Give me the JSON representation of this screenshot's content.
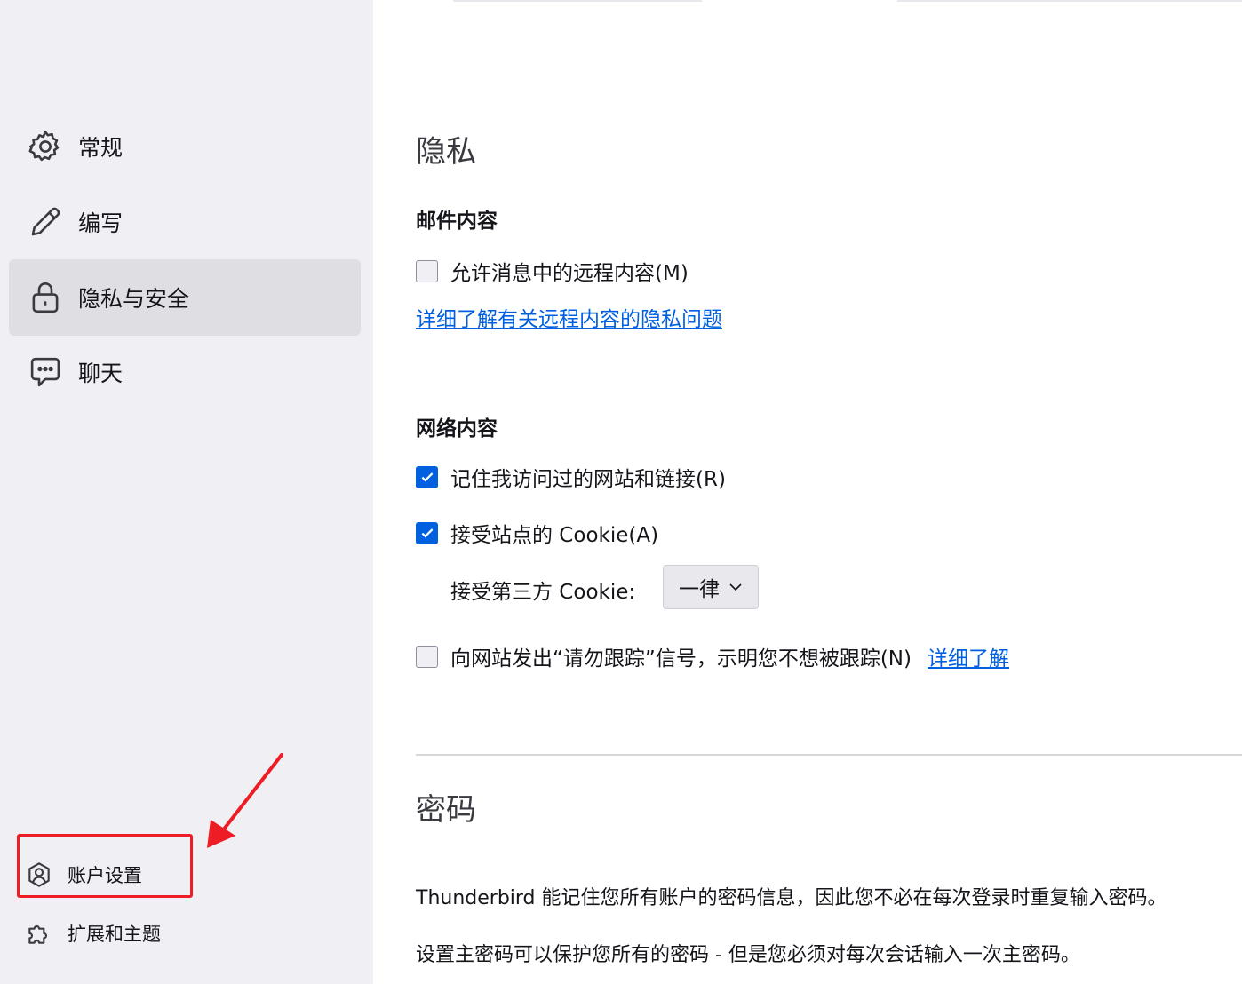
{
  "sidebar": {
    "items": [
      {
        "label": "常规",
        "icon": "gear-icon"
      },
      {
        "label": "编写",
        "icon": "pencil-icon"
      },
      {
        "label": "隐私与安全",
        "icon": "lock-icon",
        "selected": true
      },
      {
        "label": "聊天",
        "icon": "chat-icon"
      }
    ],
    "footer": [
      {
        "label": "账户设置",
        "icon": "account-icon"
      },
      {
        "label": "扩展和主题",
        "icon": "puzzle-icon"
      }
    ]
  },
  "privacy": {
    "title": "隐私",
    "mail_content": {
      "heading": "邮件内容",
      "remote_content": {
        "label": "允许消息中的远程内容(M)",
        "checked": false
      },
      "learn_more_link": "详细了解有关远程内容的隐私问题"
    },
    "web_content": {
      "heading": "网络内容",
      "remember_links": {
        "label": "记住我访问过的网站和链接(R)",
        "checked": true
      },
      "accept_cookies": {
        "label": "接受站点的 Cookie(A)",
        "checked": true
      },
      "third_party": {
        "label": "接受第三方 Cookie:",
        "value": "一律"
      },
      "do_not_track": {
        "label": "向网站发出“请勿跟踪”信号，示明您不想被跟踪(N)",
        "checked": false
      },
      "dnt_link": "详细了解"
    }
  },
  "passwords": {
    "title": "密码",
    "text1": "Thunderbird 能记住您所有账户的密码信息，因此您不必在每次登录时重复输入密码。",
    "text2": "设置主密码可以保护您所有的密码 - 但是您必须对每次会话输入一次主密码。"
  },
  "colors": {
    "accent": "#0060df",
    "annotation": "#ee1c24",
    "sidebar_bg": "#f0f0f4",
    "selected_bg": "#dfdfe3"
  }
}
